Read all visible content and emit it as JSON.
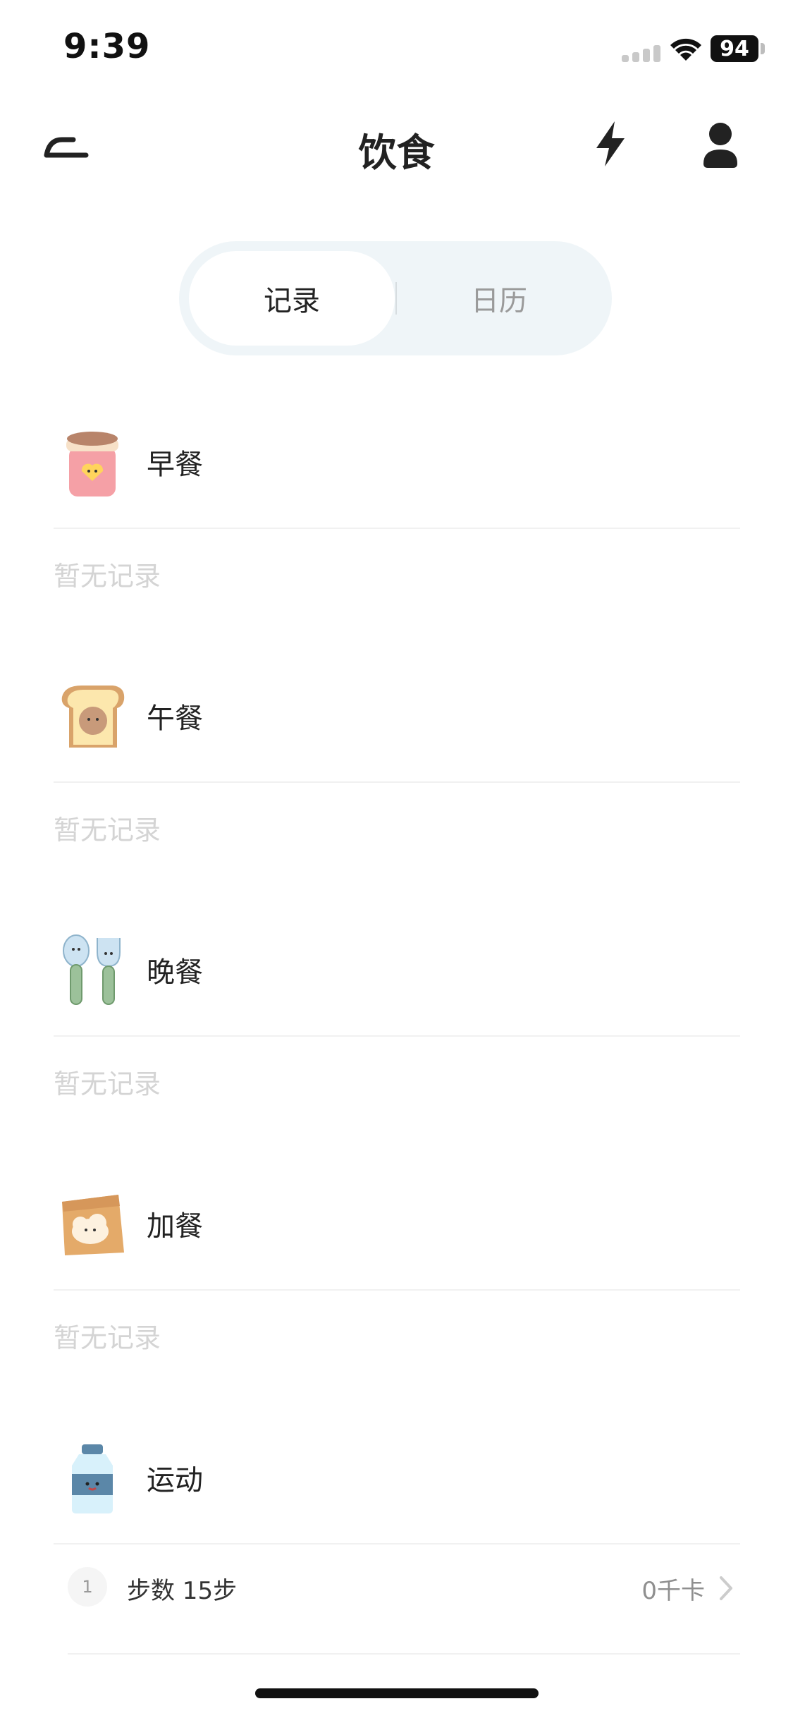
{
  "status_bar": {
    "time": "9:39",
    "battery": "94"
  },
  "nav": {
    "title": "饮食",
    "back_icon": "back-arrow-icon",
    "bolt_icon": "lightning-icon",
    "user_icon": "user-icon"
  },
  "tabs": [
    {
      "label": "记录",
      "active": true
    },
    {
      "label": "日历",
      "active": false
    }
  ],
  "sections": [
    {
      "title": "早餐",
      "icon": "breakfast-cup-icon",
      "empty_text": "暂无记录"
    },
    {
      "title": "午餐",
      "icon": "toast-bread-icon",
      "empty_text": "暂无记录"
    },
    {
      "title": "晚餐",
      "icon": "spoon-fork-icon",
      "empty_text": "暂无记录"
    },
    {
      "title": "加餐",
      "icon": "snack-bag-icon",
      "empty_text": "暂无记录"
    },
    {
      "title": "运动",
      "icon": "water-bottle-icon"
    }
  ],
  "exercise_items": [
    {
      "index": "1",
      "label": "步数 15步",
      "calories": "0千卡"
    }
  ]
}
